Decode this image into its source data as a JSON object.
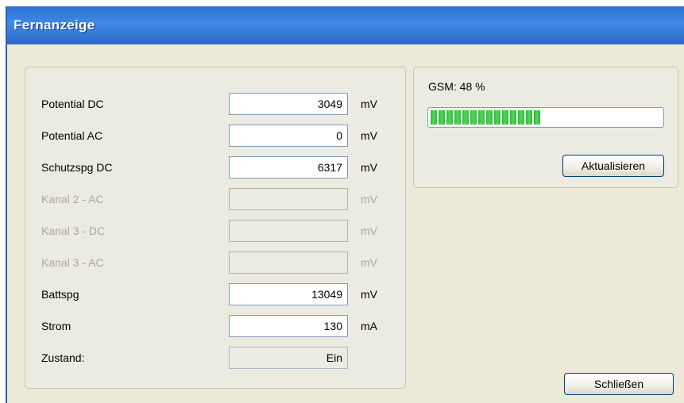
{
  "window": {
    "title": "Fernanzeige"
  },
  "rows": [
    {
      "label": "Potential DC",
      "value": "3049",
      "unit": "mV",
      "disabled": false
    },
    {
      "label": "Potential AC",
      "value": "0",
      "unit": "mV",
      "disabled": false
    },
    {
      "label": "Schutzspg DC",
      "value": "6317",
      "unit": "mV",
      "disabled": false
    },
    {
      "label": "Kanal 2 - AC",
      "value": "",
      "unit": "mV",
      "disabled": true
    },
    {
      "label": "Kanal 3 - DC",
      "value": "",
      "unit": "mV",
      "disabled": true
    },
    {
      "label": "Kanal 3 - AC",
      "value": "",
      "unit": "mV",
      "disabled": true
    },
    {
      "label": "Battspg",
      "value": "13049",
      "unit": "mV",
      "disabled": false
    },
    {
      "label": "Strom",
      "value": "130",
      "unit": "mA",
      "disabled": false
    },
    {
      "label": "Zustand:",
      "value": "Ein",
      "unit": "",
      "disabled": false
    }
  ],
  "gsm": {
    "label": "GSM: 48 %",
    "signal_percent": 48,
    "bar_color": "#2fb83a",
    "refresh_label": "Aktualisieren"
  },
  "footer": {
    "close_label": "Schließen"
  }
}
